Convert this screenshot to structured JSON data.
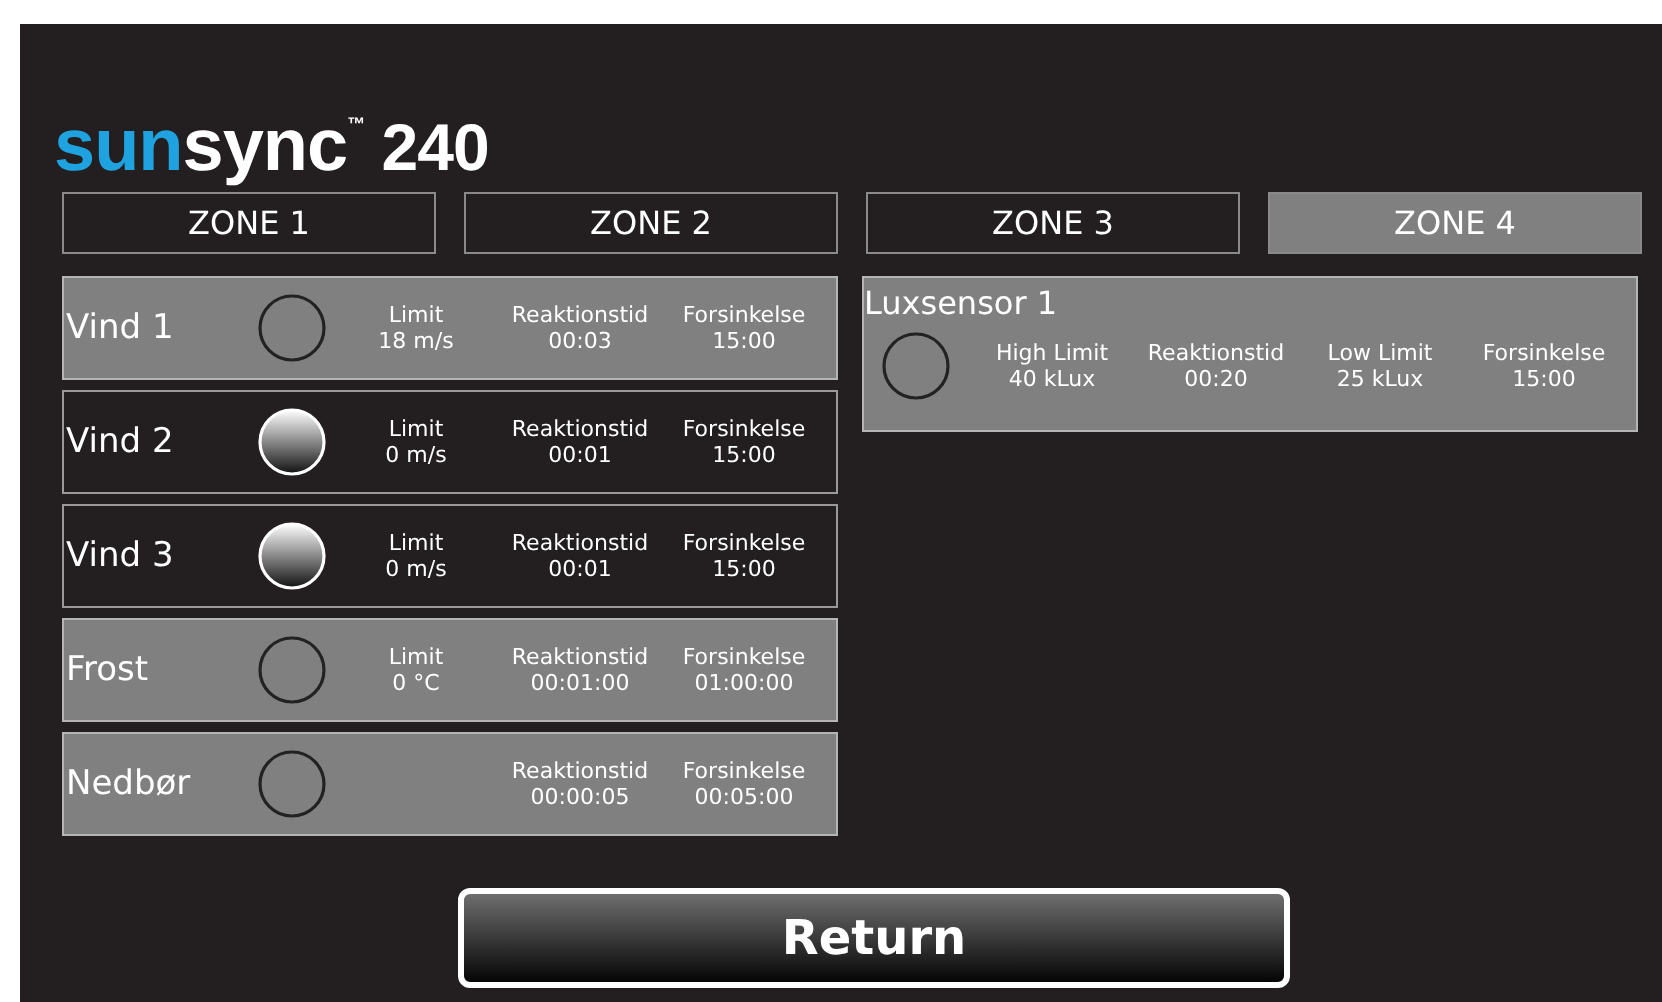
{
  "logo": {
    "brand_first": "sun",
    "brand_second": "sync",
    "trademark": "™",
    "model": "240"
  },
  "zones": [
    {
      "label": "ZONE 1",
      "selected": false
    },
    {
      "label": "ZONE 2",
      "selected": false
    },
    {
      "label": "ZONE 3",
      "selected": false
    },
    {
      "label": "ZONE 4",
      "selected": true
    }
  ],
  "sensors": [
    {
      "name": "Vind 1",
      "highlighted": true,
      "active": false,
      "fields": [
        {
          "label": "Limit",
          "value": "18 m/s"
        },
        {
          "label": "Reaktionstid",
          "value": "00:03"
        },
        {
          "label": "Forsinkelse",
          "value": "15:00"
        }
      ]
    },
    {
      "name": "Vind 2",
      "highlighted": false,
      "active": true,
      "fields": [
        {
          "label": "Limit",
          "value": "0 m/s"
        },
        {
          "label": "Reaktionstid",
          "value": "00:01"
        },
        {
          "label": "Forsinkelse",
          "value": "15:00"
        }
      ]
    },
    {
      "name": "Vind 3",
      "highlighted": false,
      "active": true,
      "fields": [
        {
          "label": "Limit",
          "value": "0 m/s"
        },
        {
          "label": "Reaktionstid",
          "value": "00:01"
        },
        {
          "label": "Forsinkelse",
          "value": "15:00"
        }
      ]
    },
    {
      "name": "Frost",
      "highlighted": true,
      "active": false,
      "fields": [
        {
          "label": "Limit",
          "value": "0 °C"
        },
        {
          "label": "Reaktionstid",
          "value": "00:01:00"
        },
        {
          "label": "Forsinkelse",
          "value": "01:00:00"
        }
      ]
    },
    {
      "name": "Nedbør",
      "highlighted": true,
      "active": false,
      "fields": [
        {
          "label": "Reaktionstid",
          "value": "00:00:05"
        },
        {
          "label": "Forsinkelse",
          "value": "00:05:00"
        }
      ]
    }
  ],
  "lux_sensors": [
    {
      "name": "Luxsensor 1",
      "highlighted": true,
      "active": false,
      "fields": [
        {
          "label": "High Limit",
          "value": "40 kLux"
        },
        {
          "label": "Reaktionstid",
          "value": "00:20"
        },
        {
          "label": "Low Limit",
          "value": "25 kLux"
        },
        {
          "label": "Forsinkelse",
          "value": "15:00"
        }
      ]
    }
  ],
  "return_button": {
    "label": "Return"
  }
}
